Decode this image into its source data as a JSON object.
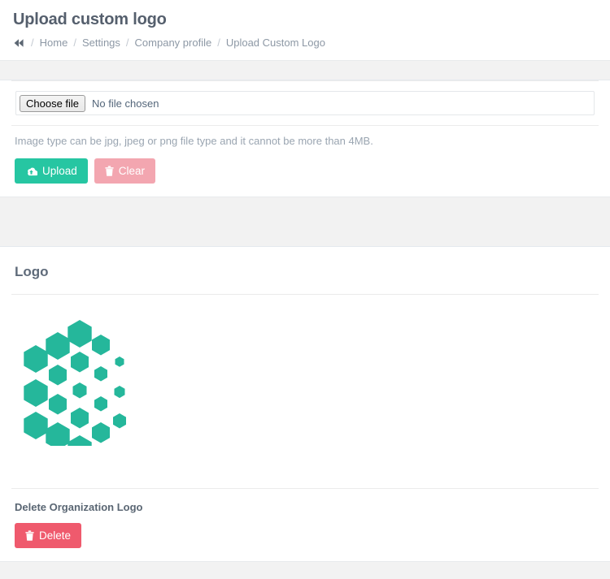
{
  "header": {
    "title": "Upload custom logo",
    "breadcrumb": {
      "home_icon": "fast-backward-icon",
      "separator": "/",
      "items": [
        {
          "label": "Home"
        },
        {
          "label": "Settings"
        },
        {
          "label": "Company profile"
        },
        {
          "label": "Upload Custom Logo"
        }
      ]
    }
  },
  "upload_panel": {
    "file_input": {
      "choose_label": "Choose file",
      "file_name": "No file chosen"
    },
    "help_text": "Image type can be jpg, jpeg or png file type and it cannot be more than 4MB.",
    "upload_button": {
      "label": "Upload",
      "icon": "cloud-upload-icon",
      "color": "#26c6a2"
    },
    "clear_button": {
      "label": "Clear",
      "icon": "trash-icon",
      "color": "#f3a6b0"
    }
  },
  "logo_panel": {
    "title": "Logo",
    "logo": {
      "alt": "organization-logo",
      "color": "#25b79b",
      "shape": "hexagon-cluster"
    },
    "delete_label": "Delete Organization Logo",
    "delete_button": {
      "label": "Delete",
      "icon": "trash-icon",
      "color": "#ef5a6d"
    }
  },
  "colors": {
    "accent_teal": "#26c6a2",
    "logo_teal": "#25b79b",
    "danger_red": "#ef5a6d",
    "danger_muted": "#f3a6b0",
    "band_gray": "#f2f2f2",
    "text": "#54667a"
  }
}
